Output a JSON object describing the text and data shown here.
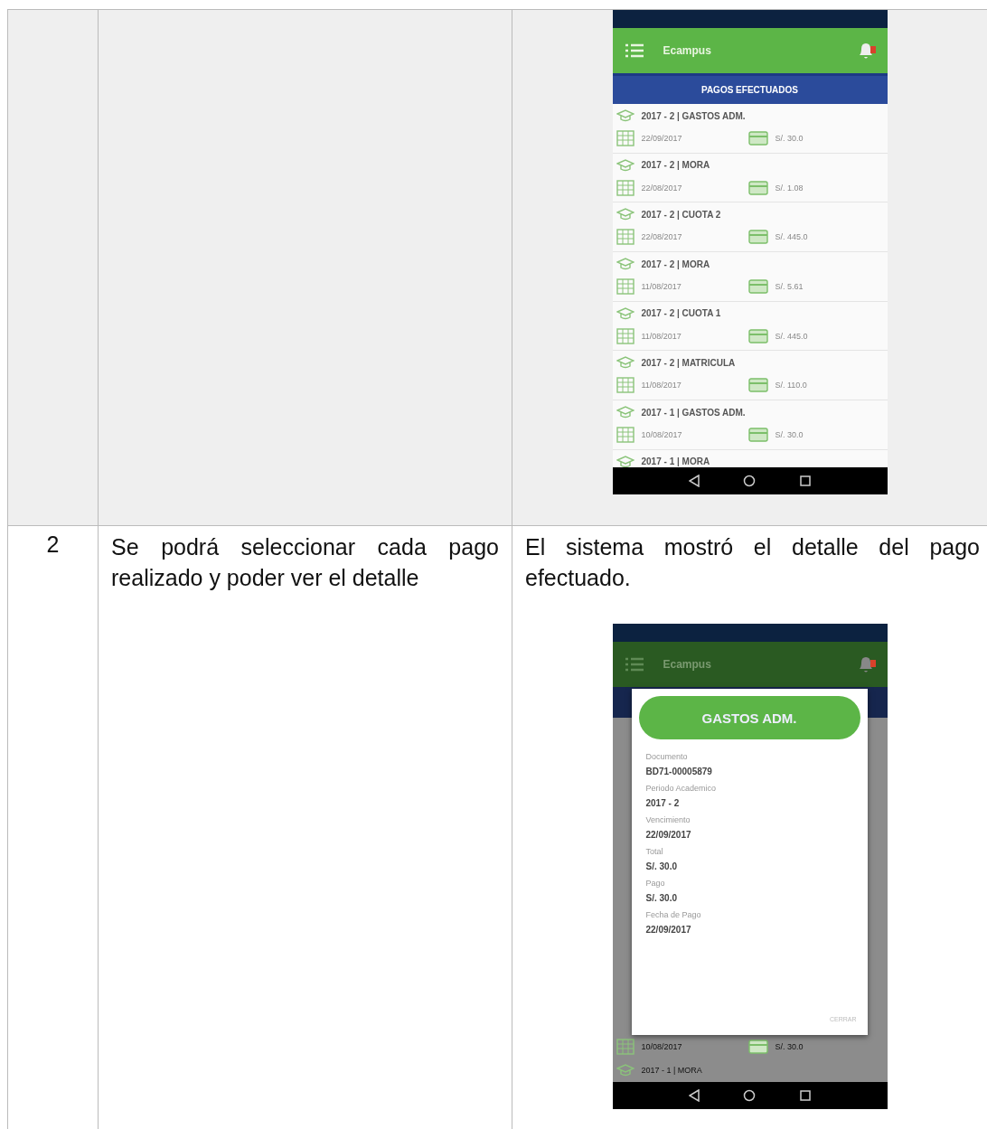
{
  "table": {
    "rows": [
      {
        "screen": {
          "kind": "list",
          "app_title": "Ecampus",
          "section_title": "PAGOS EFECTUADOS",
          "payments": [
            {
              "title": "2017 - 2 | GASTOS ADM.",
              "date": "22/09/2017",
              "amount": "S/. 30.0"
            },
            {
              "title": "2017 - 2 | MORA",
              "date": "22/08/2017",
              "amount": "S/. 1.08"
            },
            {
              "title": "2017 - 2 | CUOTA 2",
              "date": "22/08/2017",
              "amount": "S/. 445.0"
            },
            {
              "title": "2017 - 2 | MORA",
              "date": "11/08/2017",
              "amount": "S/. 5.61"
            },
            {
              "title": "2017 - 2 | CUOTA 1",
              "date": "11/08/2017",
              "amount": "S/. 445.0"
            },
            {
              "title": "2017 - 2 | MATRICULA",
              "date": "11/08/2017",
              "amount": "S/. 110.0"
            },
            {
              "title": "2017 - 1 | GASTOS ADM.",
              "date": "10/08/2017",
              "amount": "S/. 30.0"
            },
            {
              "title": "2017 - 1 | MORA"
            }
          ]
        }
      },
      {
        "number": "2",
        "requirement": "Se podrá seleccionar cada pago realizado y poder ver el detalle",
        "result": "El sistema mostró el detalle del pago efectuado.",
        "screen": {
          "kind": "detail",
          "app_title": "Ecampus",
          "dialog_title": "GASTOS ADM.",
          "fields": [
            {
              "label": "Documento",
              "value": "BD71-00005879"
            },
            {
              "label": "Periodo Academico",
              "value": "2017 - 2"
            },
            {
              "label": "Vencimiento",
              "value": "22/09/2017"
            },
            {
              "label": "Total",
              "value": "S/. 30.0"
            },
            {
              "label": "Pago",
              "value": "S/. 30.0"
            },
            {
              "label": "Fecha de Pago",
              "value": "22/09/2017"
            }
          ],
          "close_label": "CERRAR",
          "background_rows": [
            {
              "date": "10/08/2017",
              "amount": "S/. 30.0"
            },
            {
              "title": "2017 - 1 | MORA"
            }
          ]
        }
      }
    ]
  }
}
